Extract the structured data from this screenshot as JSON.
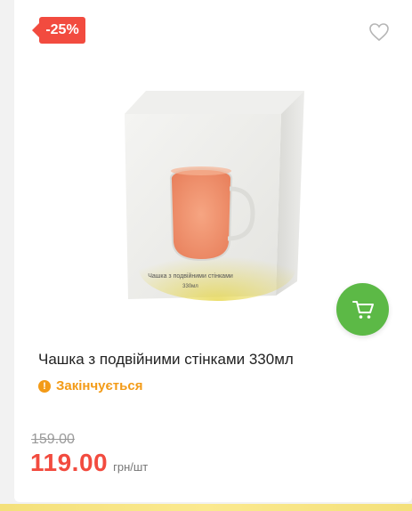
{
  "badge": {
    "discount": "-25%"
  },
  "product": {
    "title": "Чашка з подвійними стінками 330мл",
    "box_label": "Чашка з подвійними стінками",
    "box_volume": "330мл"
  },
  "stock": {
    "status": "Закінчується"
  },
  "price": {
    "old": "159.00",
    "current": "119.00",
    "unit": "грн/шт"
  },
  "colors": {
    "accent_red": "#f24b3f",
    "accent_green": "#5cb946",
    "warning_orange": "#f39b17"
  },
  "icons": {
    "favorite": "heart-outline-icon",
    "cart": "shopping-cart-icon",
    "stock": "exclamation-circle-icon"
  }
}
